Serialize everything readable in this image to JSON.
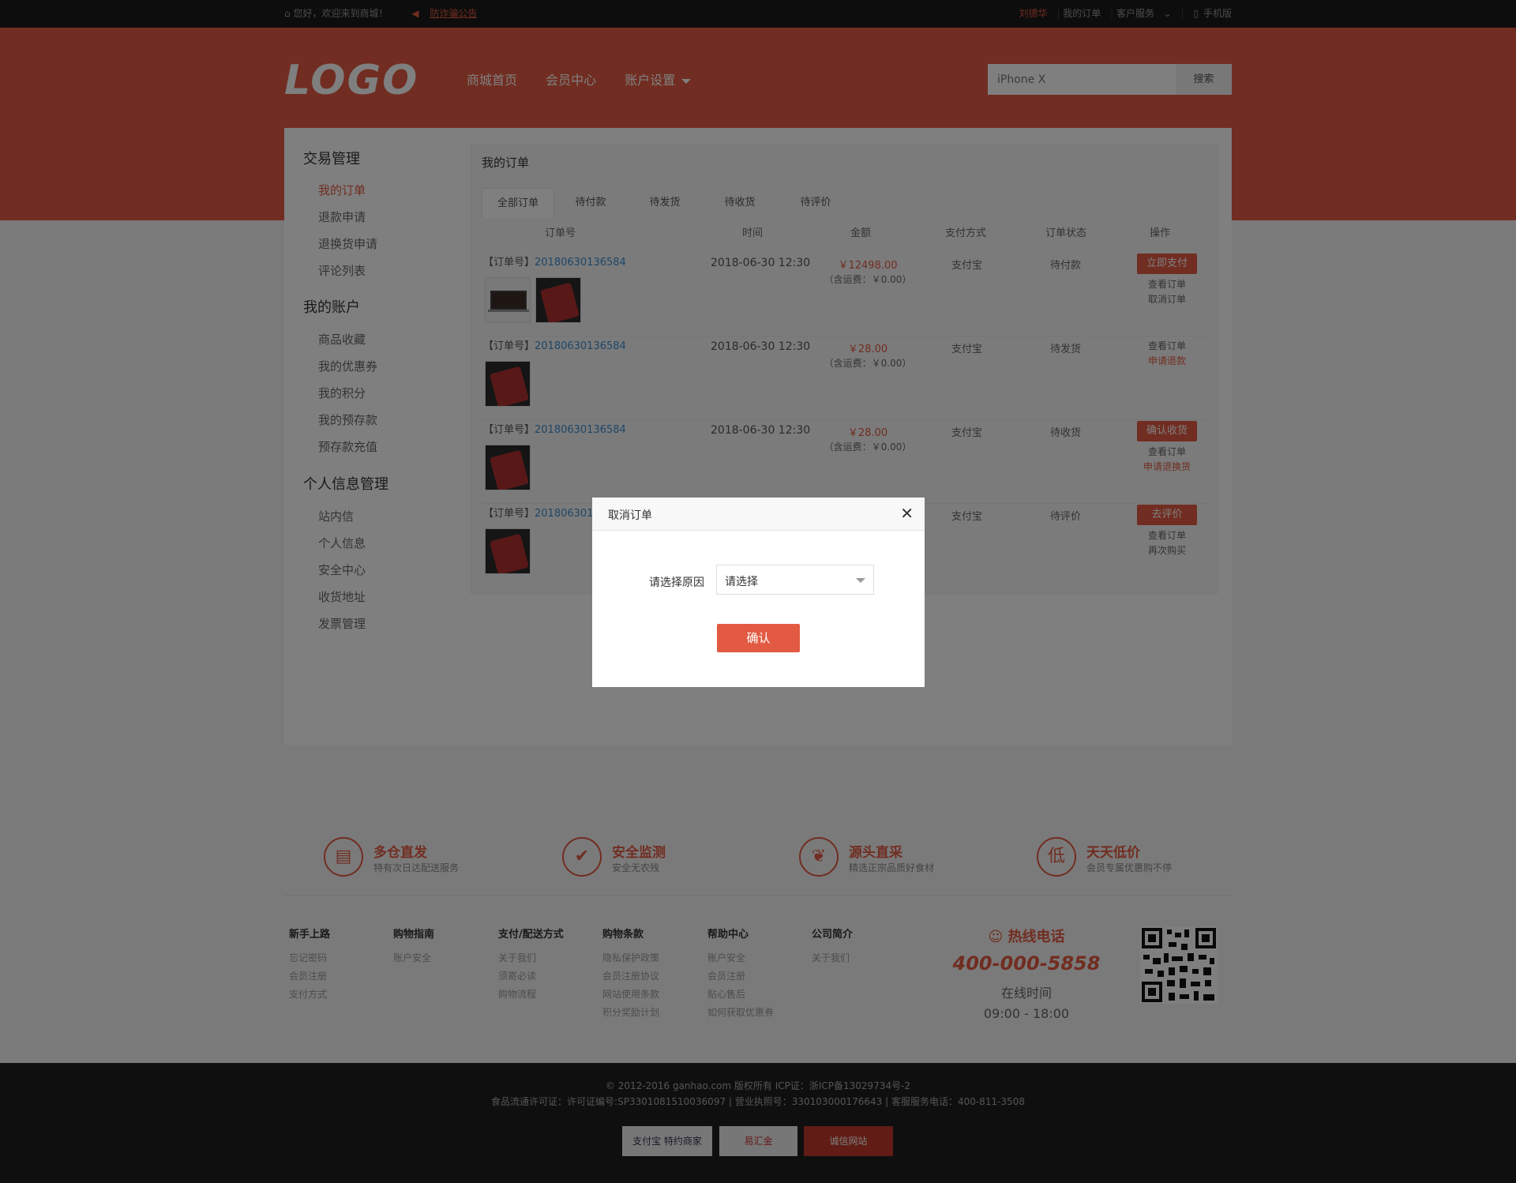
{
  "topbar": {
    "welcome": "您好，欢迎来到商城！",
    "notice": "防诈骗公告",
    "user": "刘德华",
    "my_orders": "我的订单",
    "customer_service": "客户服务",
    "mobile": "手机版"
  },
  "header": {
    "logo": "LOGO",
    "nav": [
      "商城首页",
      "会员中心",
      "账户设置"
    ],
    "search_placeholder": "iPhone X",
    "search_button": "搜索"
  },
  "sidebar": {
    "groups": [
      {
        "title": "交易管理",
        "items": [
          "我的订单",
          "退款申请",
          "退换货申请",
          "评论列表"
        ]
      },
      {
        "title": "我的账户",
        "items": [
          "商品收藏",
          "我的优惠券",
          "我的积分",
          "我的预存款",
          "预存款充值"
        ]
      },
      {
        "title": "个人信息管理",
        "items": [
          "站内信",
          "个人信息",
          "安全中心",
          "收货地址",
          "发票管理"
        ]
      }
    ]
  },
  "orders": {
    "title": "我的订单",
    "tabs": [
      "全部订单",
      "待付款",
      "待发货",
      "待收货",
      "待评价"
    ],
    "columns": [
      "订单号",
      "时间",
      "金额",
      "支付方式",
      "订单状态",
      "操作"
    ],
    "rows": [
      {
        "label": "【订单号】",
        "number": "20180630136584",
        "time": "2018-06-30 12:30",
        "amount": "￥12498.00",
        "freight": "（含运费：￥0.00）",
        "pay": "支付宝",
        "status": "待付款",
        "button": "立即支付",
        "links": [
          "查看订单",
          "取消订单"
        ]
      },
      {
        "label": "【订单号】",
        "number": "20180630136584",
        "time": "2018-06-30 12:30",
        "amount": "￥28.00",
        "freight": "（含运费：￥0.00）",
        "pay": "支付宝",
        "status": "待发货",
        "links": [
          "查看订单",
          "申请退款"
        ]
      },
      {
        "label": "【订单号】",
        "number": "20180630136584",
        "time": "2018-06-30 12:30",
        "amount": "￥28.00",
        "freight": "（含运费：￥0.00）",
        "pay": "支付宝",
        "status": "待收货",
        "button": "确认收货",
        "links": [
          "查看订单",
          "申请退换货"
        ]
      },
      {
        "label": "【订单号】",
        "number": "2018063013",
        "pay": "支付宝",
        "status": "待评价",
        "button": "去评价",
        "links": [
          "查看订单",
          "再次购买"
        ]
      }
    ]
  },
  "features": [
    {
      "icon": "warehouse-icon",
      "title": "多仓直发",
      "sub": "特有次日达配送服务"
    },
    {
      "icon": "shield-icon",
      "title": "安全监测",
      "sub": "安全无农残"
    },
    {
      "icon": "leaf-icon",
      "title": "源头直采",
      "sub": "精选正宗品质好食材"
    },
    {
      "icon": "low-price-icon",
      "title": "天天低价",
      "sub": "会员专属优惠购不停"
    }
  ],
  "footer_links": [
    {
      "title": "新手上路",
      "items": [
        "忘记密码",
        "会员注册",
        "支付方式"
      ]
    },
    {
      "title": "购物指南",
      "items": [
        "账户安全"
      ]
    },
    {
      "title": "支付/配送方式",
      "items": [
        "关于我们",
        "须寄必读",
        "购物流程"
      ]
    },
    {
      "title": "购物条款",
      "items": [
        "隐私保护政策",
        "会员注册协议",
        "网站使用条款",
        "积分奖励计划"
      ]
    },
    {
      "title": "帮助中心",
      "items": [
        "账户安全",
        "会员注册",
        "贴心售后",
        "如何获取优惠券"
      ]
    },
    {
      "title": "公司简介",
      "items": [
        "关于我们"
      ]
    }
  ],
  "hotline": {
    "title": "热线电话",
    "phone": "400-000-5858",
    "time_label": "在线时间",
    "time": "09:00 - 18:00"
  },
  "footer": {
    "copyright": "© 2012-2016 ganhao.com 版权所有 ICP证：浙ICP备13029734号-2",
    "license": "食品流通许可证：许可证编号:SP3301081510036097 | 营业执照号：330103000176643 | 客服服务电话：400-811-3508",
    "badges": [
      "支付宝 特约商家",
      "易汇金",
      "诚信网站"
    ]
  },
  "modal": {
    "title": "取消订单",
    "reason_label": "请选择原因",
    "select_value": "请选择",
    "confirm": "确认"
  }
}
